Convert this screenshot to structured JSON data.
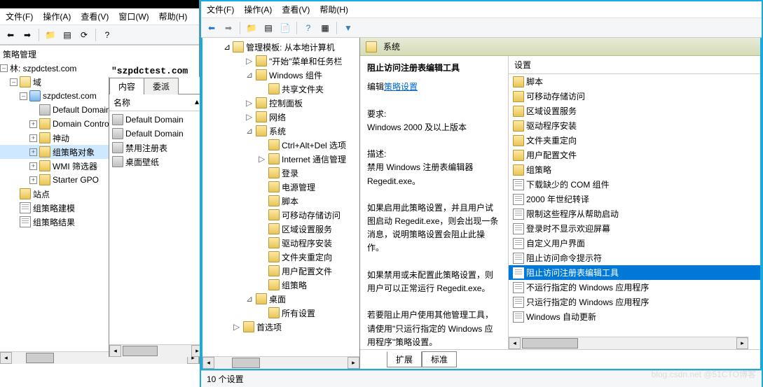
{
  "left_window": {
    "menus": [
      "文件(F)",
      "操作(A)",
      "查看(V)",
      "窗口(W)",
      "帮助(H)"
    ],
    "tree_root": "策略管理",
    "forest_label": "林: szpdctest.com",
    "domains_label": "域",
    "domain_name": "szpdctest.com",
    "items": [
      "Default Domain",
      "Domain Contro",
      "神动",
      "组策略对象",
      "WMI 筛选器",
      "Starter GPO"
    ],
    "sites": "站点",
    "modeling": "组策略建模",
    "results": "组策略结果"
  },
  "mid_overlay": {
    "domain_text": "\"szpdctest.com",
    "tabs": [
      "内容",
      "委派"
    ],
    "col_name": "名称",
    "rows": [
      "Default Domain",
      "Default Domain",
      "禁用注册表",
      "桌面壁纸"
    ]
  },
  "right_window": {
    "menus": [
      "文件(F)",
      "操作(A)",
      "查看(V)",
      "帮助(H)"
    ],
    "tree": {
      "root": "管理模板: 从本地计算机",
      "items": [
        {
          "l": 1,
          "exp": "▷",
          "label": "\"开始\"菜单和任务栏"
        },
        {
          "l": 1,
          "exp": "⊿",
          "label": "Windows 组件"
        },
        {
          "l": 2,
          "exp": "",
          "label": "共享文件夹"
        },
        {
          "l": 1,
          "exp": "▷",
          "label": "控制面板"
        },
        {
          "l": 1,
          "exp": "▷",
          "label": "网络"
        },
        {
          "l": 1,
          "exp": "⊿",
          "label": "系统"
        },
        {
          "l": 2,
          "exp": "",
          "label": "Ctrl+Alt+Del 选项"
        },
        {
          "l": 2,
          "exp": "▷",
          "label": "Internet 通信管理"
        },
        {
          "l": 2,
          "exp": "",
          "label": "登录"
        },
        {
          "l": 2,
          "exp": "",
          "label": "电源管理"
        },
        {
          "l": 2,
          "exp": "",
          "label": "脚本"
        },
        {
          "l": 2,
          "exp": "",
          "label": "可移动存储访问"
        },
        {
          "l": 2,
          "exp": "",
          "label": "区域设置服务"
        },
        {
          "l": 2,
          "exp": "",
          "label": "驱动程序安装"
        },
        {
          "l": 2,
          "exp": "",
          "label": "文件夹重定向"
        },
        {
          "l": 2,
          "exp": "",
          "label": "用户配置文件"
        },
        {
          "l": 2,
          "exp": "",
          "label": "组策略"
        },
        {
          "l": 1,
          "exp": "⊿",
          "label": "桌面"
        },
        {
          "l": 2,
          "exp": "",
          "label": "所有设置"
        },
        {
          "l": 0,
          "exp": "▷",
          "label": "首选项"
        }
      ]
    },
    "content_title": "系统",
    "desc": {
      "title": "阻止访问注册表编辑工具",
      "edit_label": "编辑",
      "policy_link": "策略设置",
      "req_label": "要求:",
      "req_text": "Windows 2000 及以上版本",
      "desc_label": "描述:",
      "desc_text": "禁用 Windows 注册表编辑器 Regedit.exe。",
      "p1": "如果启用此策略设置，并且用户试图启动 Regedit.exe，则会出现一条消息，说明策略设置会阻止此操作。",
      "p2": "如果禁用或未配置此策略设置，则用户可以正常运行 Regedit.exe。",
      "p3": "若要阻止用户使用其他管理工具，请使用\"只运行指定的 Windows 应用程序\"策略设置。"
    },
    "settings_col": "设置",
    "settings": [
      {
        "icon": "folder",
        "label": "脚本"
      },
      {
        "icon": "folder",
        "label": "可移动存储访问"
      },
      {
        "icon": "folder",
        "label": "区域设置服务"
      },
      {
        "icon": "folder",
        "label": "驱动程序安装"
      },
      {
        "icon": "folder",
        "label": "文件夹重定向"
      },
      {
        "icon": "folder",
        "label": "用户配置文件"
      },
      {
        "icon": "folder",
        "label": "组策略"
      },
      {
        "icon": "page",
        "label": "下载缺少的 COM 组件"
      },
      {
        "icon": "page",
        "label": "2000 年世纪转译"
      },
      {
        "icon": "page",
        "label": "限制这些程序从帮助启动"
      },
      {
        "icon": "page",
        "label": "登录时不显示欢迎屏幕"
      },
      {
        "icon": "page",
        "label": "自定义用户界面"
      },
      {
        "icon": "page",
        "label": "阻止访问命令提示符"
      },
      {
        "icon": "page",
        "label": "阻止访问注册表编辑工具",
        "sel": true
      },
      {
        "icon": "page",
        "label": "不运行指定的 Windows 应用程序"
      },
      {
        "icon": "page",
        "label": "只运行指定的 Windows 应用程序"
      },
      {
        "icon": "page",
        "label": "Windows 自动更新"
      }
    ],
    "bottom_tabs": [
      "扩展",
      "标准"
    ],
    "status": "10 个设置"
  },
  "watermark": "blog.csdn.net @51CTO博客"
}
